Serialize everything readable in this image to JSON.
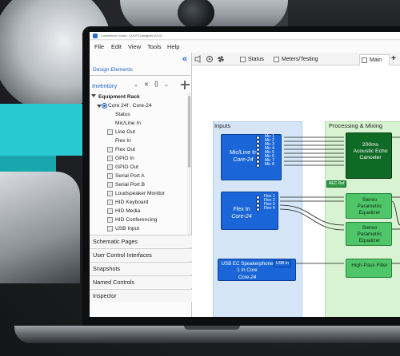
{
  "window": {
    "title": "Conference_room - Q-SYS Designer (10.0)"
  },
  "menu": [
    "File",
    "Edit",
    "View",
    "Tools",
    "Help"
  ],
  "left_panel": {
    "header": "Design Elements",
    "inventory_label": "Inventory",
    "inventory_tools": [
      "⌄",
      "✕",
      "{}",
      "⌄"
    ],
    "tree": {
      "rack": "Equipment Rack",
      "core": "Core 24f : Core-24",
      "items": [
        "Status",
        "Mic/Line In",
        "Line Out",
        "Flex In",
        "Flex Out",
        "GPIO In",
        "GPIO Out",
        "Serial Port A",
        "Serial Port B",
        "Loudspeaker Monitor",
        "HID Keyboard",
        "HID Media",
        "HID Conferencing",
        "USB Input"
      ]
    },
    "sections": [
      "Schematic Pages",
      "User Control Interfaces",
      "Snapshots",
      "Named Controls",
      "Inspector"
    ]
  },
  "tabs": [
    {
      "label": "Status"
    },
    {
      "label": "Meters/Testing"
    },
    {
      "label": "Main",
      "active": true
    }
  ],
  "schematic": {
    "columns": [
      "Inputs",
      "Processing & Mixing"
    ],
    "blocks": {
      "mic": {
        "title": "Mic/Line In",
        "subtitle": "Core-24",
        "ports": [
          "Mic 1",
          "Mic 2",
          "Mic 3",
          "Mic 4",
          "Mic 5",
          "Mic 6",
          "Mic 7",
          "Mic 8"
        ]
      },
      "flex": {
        "title": "Flex In",
        "subtitle": "Core-24",
        "ports": [
          "Flex 1",
          "Flex 2",
          "Flex 3",
          "Flex 4"
        ]
      },
      "usb": {
        "title": "USB EC Speakerphone 1 In Core",
        "subtitle": "Core-24",
        "port": "USB In"
      },
      "aec": {
        "title": "200ms Acoustic Echo Canceler",
        "ref": "AEC Ref"
      },
      "eq1": {
        "title": "Stereo Parametric Equalizer"
      },
      "eq2": {
        "title": "Stereo Parametric Equalizer"
      },
      "hpf": {
        "title": "High-Pass Filter"
      }
    }
  },
  "colors": {
    "accent": "#1c63c9",
    "block_blue": "#1a66d8",
    "block_green": "#4fc66a",
    "block_dark": "#0f6a26",
    "input_bg": "#d6e6f8",
    "proc_bg": "#d8f3d1",
    "scene_cyan": "#29c9d2"
  }
}
